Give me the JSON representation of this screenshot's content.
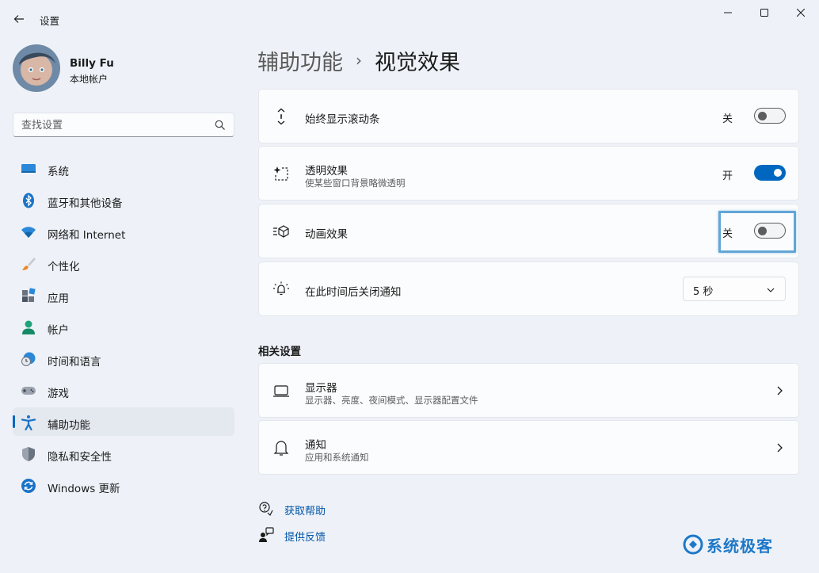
{
  "window": {
    "title": "设置"
  },
  "profile": {
    "name": "Billy Fu",
    "account_type": "本地帐户"
  },
  "search": {
    "placeholder": "查找设置"
  },
  "sidebar": {
    "items": [
      {
        "label": "系统",
        "icon": "system-icon"
      },
      {
        "label": "蓝牙和其他设备",
        "icon": "bluetooth-icon"
      },
      {
        "label": "网络和 Internet",
        "icon": "wifi-icon"
      },
      {
        "label": "个性化",
        "icon": "brush-icon"
      },
      {
        "label": "应用",
        "icon": "apps-icon"
      },
      {
        "label": "帐户",
        "icon": "account-icon"
      },
      {
        "label": "时间和语言",
        "icon": "time-language-icon"
      },
      {
        "label": "游戏",
        "icon": "gamepad-icon"
      },
      {
        "label": "辅助功能",
        "icon": "accessibility-icon",
        "active": true
      },
      {
        "label": "隐私和安全性",
        "icon": "shield-icon"
      },
      {
        "label": "Windows 更新",
        "icon": "update-icon"
      }
    ]
  },
  "header": {
    "parent": "辅助功能",
    "separator": "›",
    "current": "视觉效果"
  },
  "settings": {
    "scrollbars": {
      "title": "始终显示滚动条",
      "state": "关",
      "on": false
    },
    "transparency": {
      "title": "透明效果",
      "subtitle": "使某些窗口背景略微透明",
      "state": "开",
      "on": true
    },
    "animation": {
      "title": "动画效果",
      "state": "关",
      "on": false
    },
    "notification_timeout": {
      "title": "在此时间后关闭通知",
      "value": "5 秒"
    }
  },
  "related": {
    "title": "相关设置",
    "items": [
      {
        "title": "显示器",
        "subtitle": "显示器、亮度、夜间模式、显示器配置文件"
      },
      {
        "title": "通知",
        "subtitle": "应用和系统通知"
      }
    ]
  },
  "help_links": {
    "get_help": "获取帮助",
    "feedback": "提供反馈"
  },
  "watermark": {
    "text": "系统极客"
  },
  "colors": {
    "accent": "#0067c0",
    "background": "#eef2f8",
    "card": "#fbfcfd",
    "highlight": "#62a6d6"
  }
}
